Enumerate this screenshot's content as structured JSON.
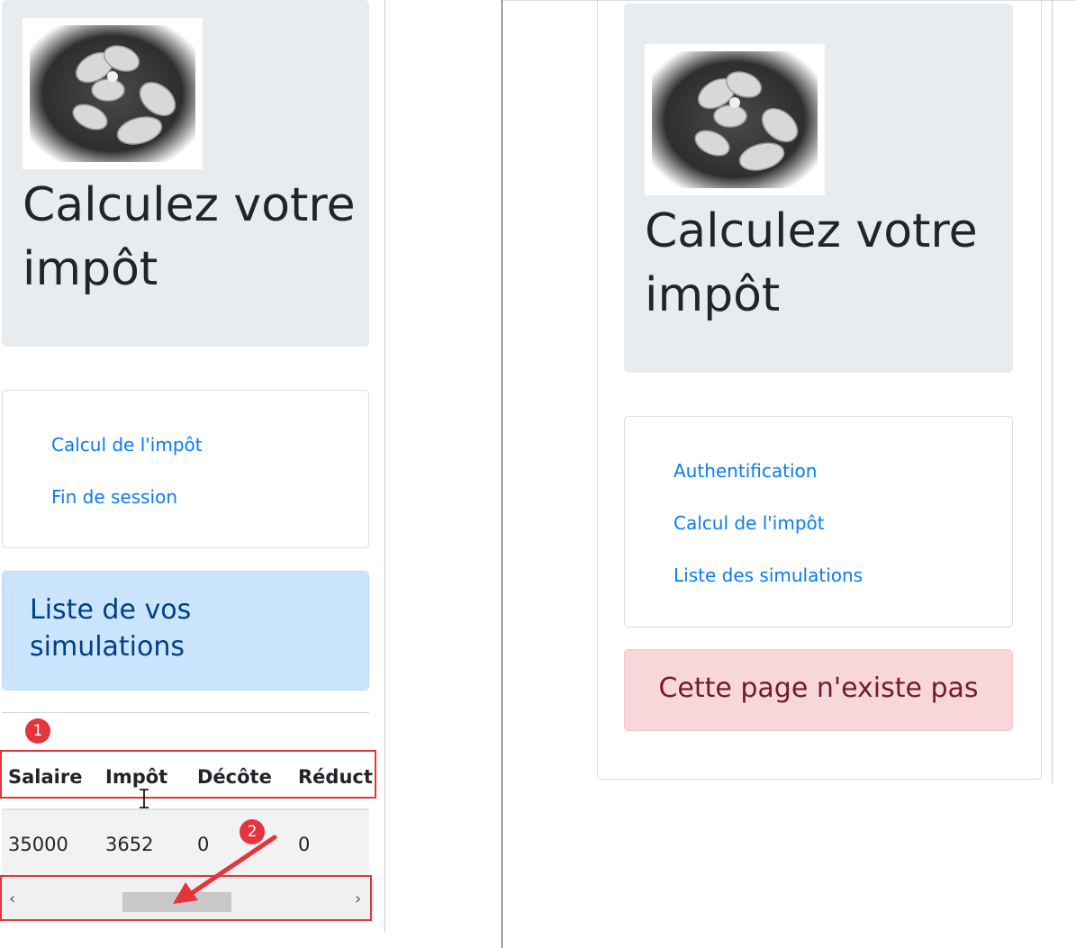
{
  "left_panel": {
    "title": "Calculez votre impôt",
    "menu": [
      "Calcul de l'impôt",
      "Fin de session"
    ],
    "alert": "Liste de vos simulations",
    "table": {
      "headers": [
        "Salaire",
        "Impôt",
        "Décôte",
        "Réducti"
      ],
      "rows": [
        [
          "35000",
          "3652",
          "0",
          "0"
        ]
      ]
    },
    "scroll_left": "‹",
    "scroll_right": "›"
  },
  "right_panel": {
    "title": "Calculez votre impôt",
    "menu": [
      "Authentification",
      "Calcul de l'impôt",
      "Liste des simulations"
    ],
    "error": "Cette page n'existe pas"
  },
  "annotations": {
    "badge1": "1",
    "badge2": "2"
  },
  "colors": {
    "link": "#0a7bf5",
    "jumbotron": "#e9ecef",
    "info_bg": "#cce5ff",
    "info_text": "#004085",
    "danger_bg": "#f8d7da",
    "danger_text": "#721c24",
    "annotation": "#e3353b"
  }
}
